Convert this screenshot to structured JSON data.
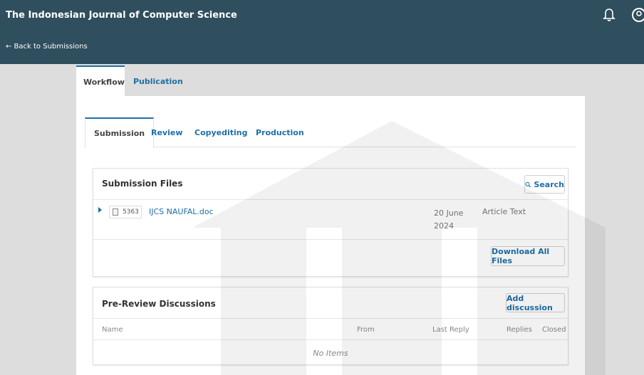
{
  "header": {
    "site_title": "The Indonesian Journal of Computer Science",
    "back_link": "← Back to Submissions"
  },
  "main_tabs": [
    {
      "label": "Workflow"
    },
    {
      "label": "Publication"
    }
  ],
  "workflow_tabs": [
    {
      "label": "Submission"
    },
    {
      "label": "Review"
    },
    {
      "label": "Copyediting"
    },
    {
      "label": "Production"
    }
  ],
  "submission_files": {
    "title": "Submission Files",
    "search_label": "Search",
    "files": [
      {
        "id": "5363",
        "name": "IJCS NAUFAL.doc",
        "date_line1": "20 June",
        "date_line2": "2024",
        "type": "Article Text"
      }
    ],
    "download_all_label": "Download All Files"
  },
  "discussions": {
    "title": "Pre-Review Discussions",
    "add_label": "Add discussion",
    "columns": [
      "Name",
      "From",
      "Last Reply",
      "Replies",
      "Closed"
    ],
    "empty_text": "No Items"
  },
  "colors": {
    "header_bg": "#2f4e5e",
    "link": "#1e6fa8",
    "page_bg": "#dddddd"
  }
}
